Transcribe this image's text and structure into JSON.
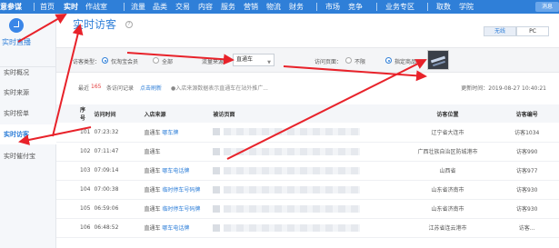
{
  "topnav": {
    "brand": "意参谋",
    "items": [
      "首页",
      "实时",
      "作战室",
      "流量",
      "品类",
      "交易",
      "内容",
      "服务",
      "营销",
      "物流",
      "财务",
      "市场",
      "竞争",
      "业务专区",
      "取数",
      "学院"
    ],
    "user_label": "消息"
  },
  "sidebar": {
    "title": "实时直播",
    "items": [
      "实时概况",
      "实时来源",
      "实时榜单",
      "实时访客",
      "实时催付宝"
    ]
  },
  "main": {
    "title": "实时访客",
    "toggle": [
      "无线",
      "PC"
    ],
    "filters": {
      "visitor_type_label": "访客类型：",
      "visitor_types": [
        "仅淘宝会员",
        "全部"
      ],
      "source_label": "流量来源：",
      "source_value": "直通车",
      "page_label": "访问页面：",
      "page_options": [
        "不限",
        "指定商品"
      ]
    },
    "info": {
      "prefix": "最近",
      "count": "165",
      "suffix": "条访问记录",
      "refresh": "点击刷新",
      "note": "●入店来源数据表示直通车在站外推广...",
      "updated": "更新时间：2019-08-27 10:40:21"
    },
    "table": {
      "columns": [
        "序号",
        "访问时间",
        "入店来源",
        "被访页面",
        "访客位置",
        "访客编号"
      ],
      "rows": [
        {
          "no": "101",
          "time": "07:23:32",
          "source": "直通车",
          "keyword": "哪车牌",
          "location": "辽宁省大连市",
          "visitor": "访客1034"
        },
        {
          "no": "102",
          "time": "07:11:47",
          "source": "直通车",
          "keyword": "",
          "location": "广西壮族自治区防城港市",
          "visitor": "访客990"
        },
        {
          "no": "103",
          "time": "07:09:14",
          "source": "直通车",
          "keyword": "哪车电话牌",
          "location": "山西省",
          "visitor": "访客977"
        },
        {
          "no": "104",
          "time": "07:00:38",
          "source": "直通车",
          "keyword": "临时停车号码牌",
          "location": "山东省济南市",
          "visitor": "访客930"
        },
        {
          "no": "105",
          "time": "06:59:06",
          "source": "直通车",
          "keyword": "临时停车号码牌",
          "location": "山东省济南市",
          "visitor": "访客930"
        },
        {
          "no": "106",
          "time": "06:48:52",
          "source": "直通车",
          "keyword": "哪车电话牌",
          "location": "江苏省连云港市",
          "visitor": "访客…"
        }
      ]
    }
  },
  "colors": {
    "brand": "#2f7fd8",
    "highlight": "#e23b3b",
    "arrow": "#e8222a"
  }
}
